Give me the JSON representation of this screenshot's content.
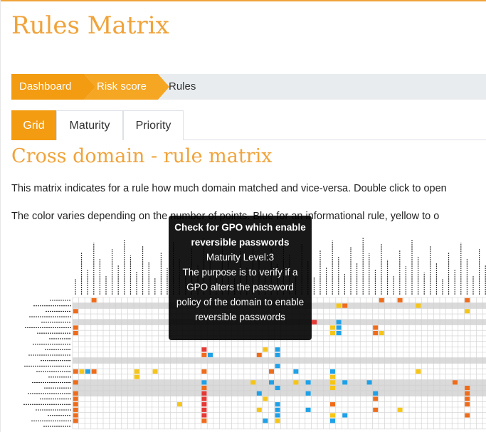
{
  "page": {
    "title": "Rules Matrix"
  },
  "breadcrumb": {
    "items": [
      "Dashboard",
      "Risk score",
      "Rules"
    ]
  },
  "tabs": [
    "Grid",
    "Maturity",
    "Priority"
  ],
  "section": {
    "title": "Cross domain - rule matrix",
    "paragraph1": "This matrix indicates for a rule how much domain matched and vice-versa. Double click to open",
    "paragraph2": "The color varies depending on the number of points. Blue for an informational rule, yellow to o"
  },
  "tooltip": {
    "title": "Check for GPO which enable reversible passwords",
    "maturity": "Maturity Level:3",
    "description": "The purpose is to verify if a GPO alters the password policy of the domain to enable reversible passwords"
  },
  "colors": {
    "accent": "#f39c12",
    "orange": "#ef6c1a",
    "red": "#e53935",
    "yellow": "#f5c518",
    "blue": "#1ea1e8",
    "grey_row": "#dadada"
  }
}
